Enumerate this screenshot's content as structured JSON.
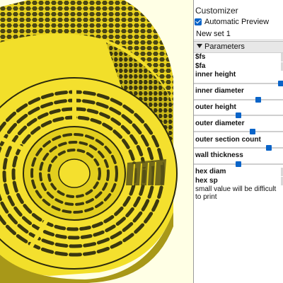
{
  "customizer": {
    "title": "Customizer",
    "automatic_preview": {
      "label": "Automatic Preview",
      "checked": true
    },
    "preset": {
      "value": "New set 1"
    },
    "section": {
      "label": "Parameters",
      "expanded": true
    },
    "params": [
      {
        "label": "$fs"
      },
      {
        "label": "$fa"
      },
      {
        "label": "inner height",
        "slider_fraction": 0.98
      },
      {
        "label": "inner diameter",
        "slider_fraction": 0.72
      },
      {
        "label": "outer height",
        "slider_fraction": 0.5
      },
      {
        "label": "outer diameter",
        "slider_fraction": 0.66
      },
      {
        "label": "outer section count",
        "slider_fraction": 0.84
      },
      {
        "label": "wall thickness",
        "slider_fraction": 0.5
      },
      {
        "label": "hex diam"
      },
      {
        "label": "hex sp",
        "description": "small value will be difficult to print"
      }
    ]
  },
  "colors": {
    "viewport_background": "#ffffe5",
    "model_yellow": "#f4de2a",
    "model_shadow": "#3d3a12",
    "accent_blue": "#0a64c8"
  }
}
